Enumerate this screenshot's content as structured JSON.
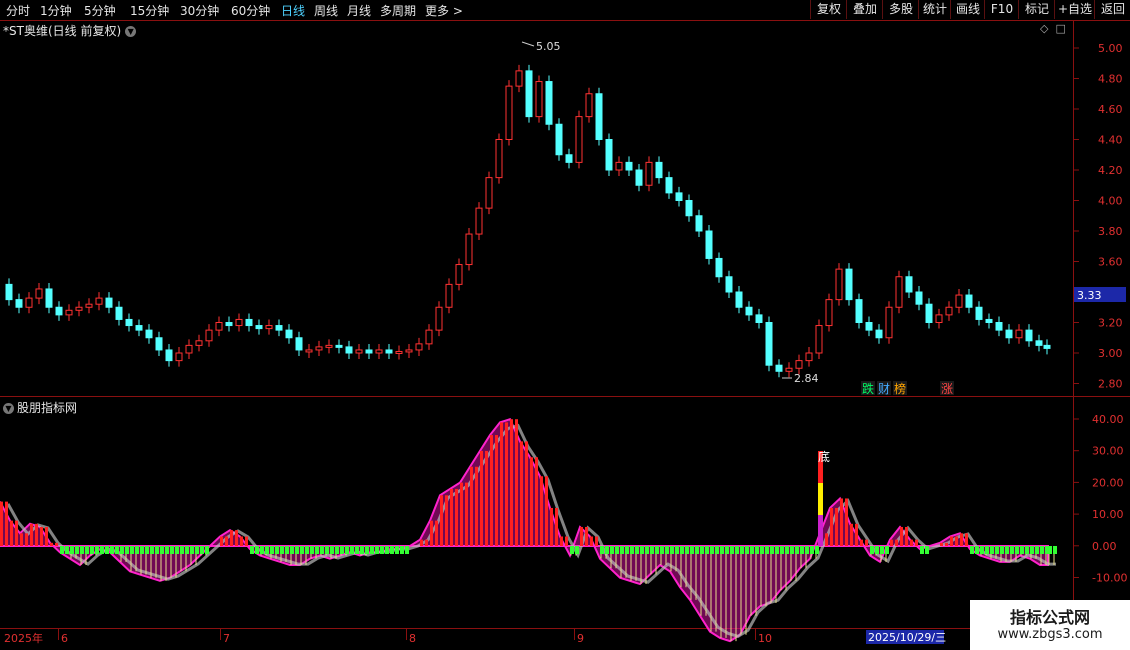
{
  "toolbar": {
    "periods": [
      "分时",
      "1分钟",
      "5分钟",
      "15分钟",
      "30分钟",
      "60分钟",
      "日线",
      "周线",
      "月线",
      "多周期",
      "更多 >"
    ],
    "active_period": "日线",
    "right_buttons": [
      "复权",
      "叠加",
      "多股",
      "统计",
      "画线",
      "F10",
      "标记",
      "+自选",
      "返回"
    ]
  },
  "stock_title": "*ST奥维(日线 前复权)",
  "indicator_title": "股朋指标网",
  "price_axis": [
    "5.00",
    "4.80",
    "4.60",
    "4.40",
    "4.20",
    "4.00",
    "3.80",
    "3.60",
    "3.40",
    "3.20",
    "3.00",
    "2.80"
  ],
  "price_label": "3.33",
  "high_label": "5.05",
  "low_label": "2.84",
  "indicator_axis": [
    "40.00",
    "30.00",
    "20.00",
    "10.00",
    "0.00",
    "-10.00"
  ],
  "date_axis": [
    "2025年",
    "6",
    "7",
    "8",
    "9",
    "10"
  ],
  "cursor_date": "2025/10/29/三",
  "badges": [
    {
      "text": "跌",
      "color": "#00ff66"
    },
    {
      "text": "财",
      "color": "#44aaff"
    },
    {
      "text": "榜",
      "color": "#ffa500"
    },
    {
      "text": "涨",
      "color": "#ff4444"
    }
  ],
  "signal_label": "底",
  "watermark": {
    "line1": "指标公式网",
    "line2": "www.zbgs3.com"
  },
  "colors": {
    "up": "#ff3232",
    "down": "#54ffff",
    "accent": "#4fd2ff",
    "panel_border": "#8a1010"
  }
}
